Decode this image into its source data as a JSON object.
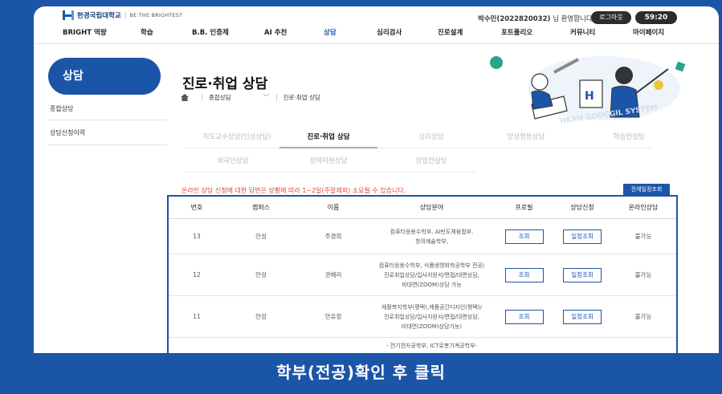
{
  "topbar": {
    "logo_name": "한경국립대학교",
    "logo_slogan": "BE THE BRIGHTEST",
    "welcome_name": "박수민(2022820032)",
    "welcome_suffix": " 님 환영합니다",
    "logout_label": "로그아웃",
    "timer": "59:20"
  },
  "nav": {
    "items": [
      "BRIGHT 역량",
      "학습",
      "B.B. 인증제",
      "AI 추천",
      "상담",
      "심리검사",
      "진로설계",
      "포트폴리오",
      "커뮤니티",
      "마이페이지"
    ],
    "active": "상담"
  },
  "sidebar": {
    "title": "상담",
    "items": [
      "종합상담",
      "상담신청이력"
    ]
  },
  "page": {
    "title": "진로·취업 상담",
    "breadcrumb": [
      "종합상담",
      "진로·취업 상담"
    ],
    "illustration_text": "HKNU GOOGGIL SYSTEM"
  },
  "tabs": {
    "row1": [
      "지도교수상담(인성상담)",
      "진로·취업 상담",
      "심리상담",
      "양성평등상담",
      "학습컨설팅"
    ],
    "row2": [
      "외국인상담",
      "장애지원상담",
      "창업컨설팅"
    ],
    "active": "진로·취업 상담"
  },
  "notice": "온라인 상담 신청에 대한 답변은 상황에 따라 1~2일(주말제외) 소요될 수 있습니다.",
  "all_schedule_label": "전체일정조회",
  "table": {
    "headers": [
      "번호",
      "캠퍼스",
      "이름",
      "상담분야",
      "프로필",
      "상담신청",
      "온라인상담"
    ],
    "rows": [
      {
        "no": "13",
        "campus": "안성",
        "name": "주경희",
        "field": [
          "컴퓨터응용수학부, AI반도체융합부,",
          "창의예술학부,"
        ],
        "profile": "조회",
        "apply": "일정조회",
        "online": "불가능"
      },
      {
        "no": "12",
        "campus": "안성",
        "name": "권혜리",
        "field": [
          "컴퓨터응용수학부, 식품생명화학공학부 전공/",
          "진로취업상담/입사지원서/면접/대면상담,",
          "비대면(ZOOM)상담 가능"
        ],
        "profile": "조회",
        "apply": "일정조회",
        "online": "불가능"
      },
      {
        "no": "11",
        "campus": "안성",
        "name": "안유정",
        "field": [
          "재활복지학부(평택),제품공간디자인(평택)/",
          "진로취업상담/입사지원서/면접/대면상담,",
          "비대면(ZOOM)상담가능)"
        ],
        "profile": "조회",
        "apply": "일정조회",
        "online": "불가능"
      },
      {
        "no": "",
        "campus": "",
        "name": "",
        "field": [
          "- 전기전자공학부, ICT로봇기계공학부-"
        ],
        "profile": "",
        "apply": "",
        "online": ""
      }
    ]
  },
  "caption": "학부(전공)확인 후 클릭",
  "colors": {
    "brand": "#1b55a8",
    "notice": "#e0463a"
  }
}
